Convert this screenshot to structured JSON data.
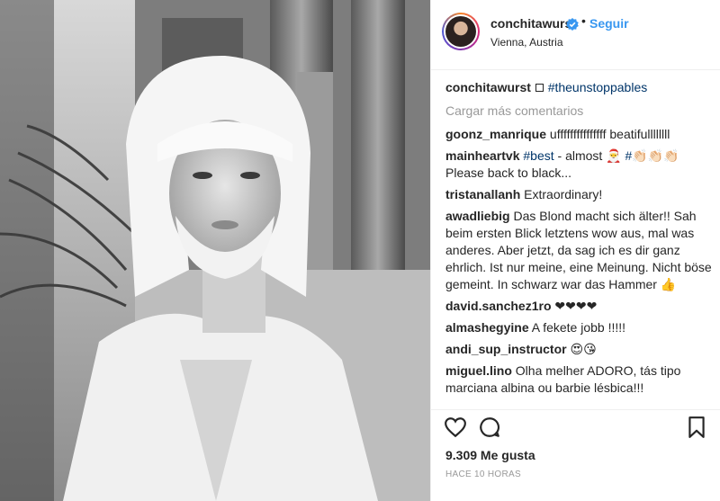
{
  "header": {
    "username": "conchitawurst",
    "dot": "•",
    "follow_label": "Seguir",
    "location": "Vienna, Austria"
  },
  "caption": {
    "username": "conchitawurst",
    "hashtag": "#theunstoppables"
  },
  "load_more_label": "Cargar más comentarios",
  "comments": [
    {
      "user": "goonz_manrique",
      "text": "ufffffffffffffff beatifullllllll"
    },
    {
      "user": "mainheartvk",
      "tag": "#best",
      "text": " - almost 🎅 ",
      "tag2": "#",
      "text2": "👏🏻👏🏻👏🏻 Please back to black..."
    },
    {
      "user": "tristanallanh",
      "text": "Extraordinary!"
    },
    {
      "user": "awadliebig",
      "text": "Das Blond macht sich älter!! Sah beim ersten Blick letztens wow aus, mal was anderes. Aber jetzt, da sag ich es dir ganz ehrlich. Ist nur meine, eine Meinung. Nicht böse gemeint. In schwarz war das Hammer 👍"
    },
    {
      "user": "david.sanchez1ro",
      "text": "❤❤❤❤"
    },
    {
      "user": "almashegyine",
      "text": "A fekete jobb !!!!!"
    },
    {
      "user": "andi_sup_instructor",
      "text": "😍😘"
    },
    {
      "user": "miguel.lino",
      "text": "Olha melher ADORO, tás tipo marciana albina ou barbie lésbica!!!"
    }
  ],
  "likes": "9.309 Me gusta",
  "timestamp": "HACE 10 HORAS",
  "icons": {
    "like": "heart-icon",
    "comment": "comment-bubble-icon",
    "save": "bookmark-icon",
    "verified": "verified-badge-icon"
  },
  "colors": {
    "link": "#3897f0",
    "hashtag": "#003569",
    "muted": "#999999"
  }
}
